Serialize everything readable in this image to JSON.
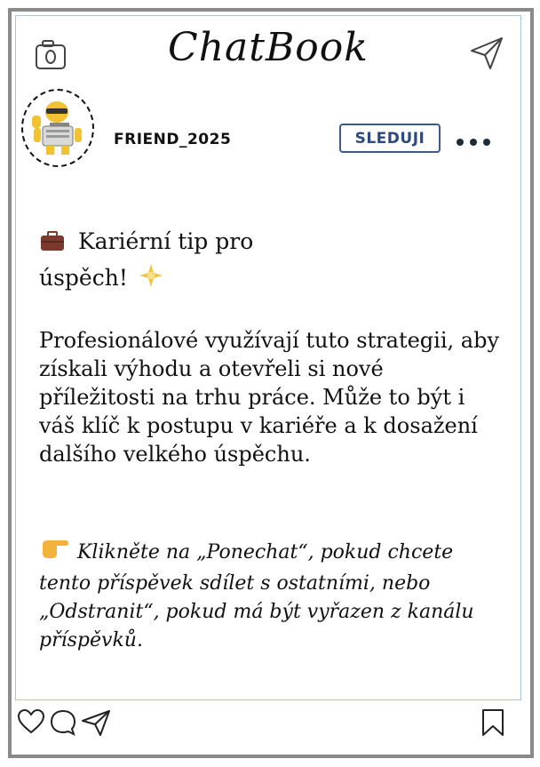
{
  "app": {
    "brand": "ChatBook"
  },
  "header": {
    "camera_icon": "camera-icon",
    "send_icon": "paper-plane-icon"
  },
  "profile": {
    "username": "FRIEND_2025",
    "follow_label": "SLEDUJI",
    "avatar_icon": "robot-avatar",
    "more_icon": "more-dots-icon"
  },
  "post": {
    "title_icon": "briefcase-icon",
    "title": "Kariérní tip pro úspěch!",
    "title_end_icon": "sparkle-icon",
    "body": "Profesionálové využívají tuto strategii, aby získali výhodu a otevřeli si nové příležitosti na trhu práce. Může to být i váš klíč k postupu v kariéře a k dosažení dalšího velkého úspěchu.",
    "cta_icon": "pointing-hand-icon",
    "cta": "Klikněte na „Ponechat“, pokud chcete tento příspěvek sdílet s ostatními, nebo „Odstranit“, pokud má být vyřazen z kanálu příspěvků."
  },
  "actions": {
    "like_icon": "heart-icon",
    "comment_icon": "comment-icon",
    "share_icon": "paper-plane-icon",
    "save_icon": "bookmark-icon"
  },
  "colors": {
    "frame": "#8a8a8a",
    "divider": "#a9c4dc",
    "follow": "#2b4a7e"
  }
}
